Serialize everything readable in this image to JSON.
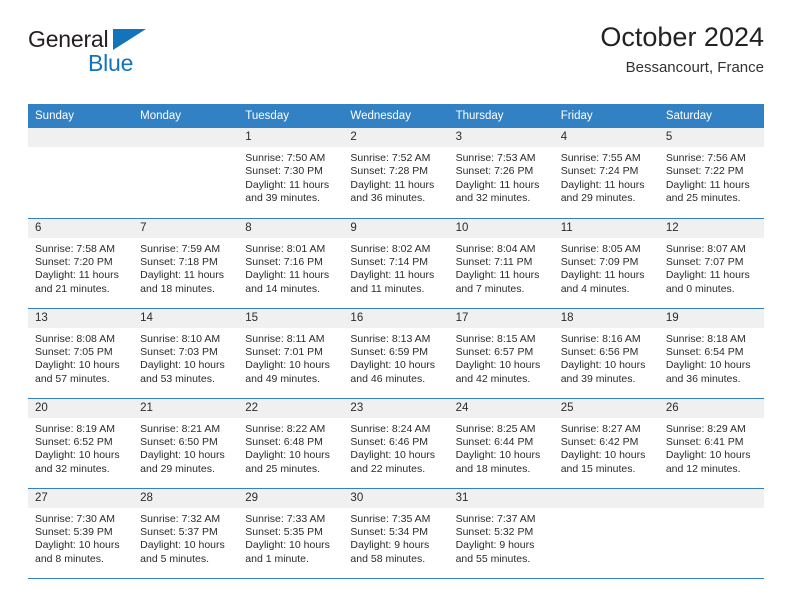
{
  "brand": {
    "name_dark": "General",
    "name_blue": "Blue",
    "triangle_icon": "blue-triangle-logo-mark"
  },
  "header": {
    "title": "October 2024",
    "location": "Bessancourt, France"
  },
  "colors": {
    "header_blue": "#3281c4",
    "brand_blue": "#1474bb",
    "daynum_band": "#f0f0f0",
    "text": "#2b2b2b"
  },
  "weekday_headers": [
    "Sunday",
    "Monday",
    "Tuesday",
    "Wednesday",
    "Thursday",
    "Friday",
    "Saturday"
  ],
  "labels": {
    "sunrise_prefix": "Sunrise:",
    "sunset_prefix": "Sunset:",
    "daylight_prefix": "Daylight:"
  },
  "weeks": [
    [
      {
        "day": "",
        "sunrise": "",
        "sunset": "",
        "daylight_line1": "",
        "daylight_line2": ""
      },
      {
        "day": "",
        "sunrise": "",
        "sunset": "",
        "daylight_line1": "",
        "daylight_line2": ""
      },
      {
        "day": "1",
        "sunrise": "Sunrise: 7:50 AM",
        "sunset": "Sunset: 7:30 PM",
        "daylight_line1": "Daylight: 11 hours",
        "daylight_line2": "and 39 minutes."
      },
      {
        "day": "2",
        "sunrise": "Sunrise: 7:52 AM",
        "sunset": "Sunset: 7:28 PM",
        "daylight_line1": "Daylight: 11 hours",
        "daylight_line2": "and 36 minutes."
      },
      {
        "day": "3",
        "sunrise": "Sunrise: 7:53 AM",
        "sunset": "Sunset: 7:26 PM",
        "daylight_line1": "Daylight: 11 hours",
        "daylight_line2": "and 32 minutes."
      },
      {
        "day": "4",
        "sunrise": "Sunrise: 7:55 AM",
        "sunset": "Sunset: 7:24 PM",
        "daylight_line1": "Daylight: 11 hours",
        "daylight_line2": "and 29 minutes."
      },
      {
        "day": "5",
        "sunrise": "Sunrise: 7:56 AM",
        "sunset": "Sunset: 7:22 PM",
        "daylight_line1": "Daylight: 11 hours",
        "daylight_line2": "and 25 minutes."
      }
    ],
    [
      {
        "day": "6",
        "sunrise": "Sunrise: 7:58 AM",
        "sunset": "Sunset: 7:20 PM",
        "daylight_line1": "Daylight: 11 hours",
        "daylight_line2": "and 21 minutes."
      },
      {
        "day": "7",
        "sunrise": "Sunrise: 7:59 AM",
        "sunset": "Sunset: 7:18 PM",
        "daylight_line1": "Daylight: 11 hours",
        "daylight_line2": "and 18 minutes."
      },
      {
        "day": "8",
        "sunrise": "Sunrise: 8:01 AM",
        "sunset": "Sunset: 7:16 PM",
        "daylight_line1": "Daylight: 11 hours",
        "daylight_line2": "and 14 minutes."
      },
      {
        "day": "9",
        "sunrise": "Sunrise: 8:02 AM",
        "sunset": "Sunset: 7:14 PM",
        "daylight_line1": "Daylight: 11 hours",
        "daylight_line2": "and 11 minutes."
      },
      {
        "day": "10",
        "sunrise": "Sunrise: 8:04 AM",
        "sunset": "Sunset: 7:11 PM",
        "daylight_line1": "Daylight: 11 hours",
        "daylight_line2": "and 7 minutes."
      },
      {
        "day": "11",
        "sunrise": "Sunrise: 8:05 AM",
        "sunset": "Sunset: 7:09 PM",
        "daylight_line1": "Daylight: 11 hours",
        "daylight_line2": "and 4 minutes."
      },
      {
        "day": "12",
        "sunrise": "Sunrise: 8:07 AM",
        "sunset": "Sunset: 7:07 PM",
        "daylight_line1": "Daylight: 11 hours",
        "daylight_line2": "and 0 minutes."
      }
    ],
    [
      {
        "day": "13",
        "sunrise": "Sunrise: 8:08 AM",
        "sunset": "Sunset: 7:05 PM",
        "daylight_line1": "Daylight: 10 hours",
        "daylight_line2": "and 57 minutes."
      },
      {
        "day": "14",
        "sunrise": "Sunrise: 8:10 AM",
        "sunset": "Sunset: 7:03 PM",
        "daylight_line1": "Daylight: 10 hours",
        "daylight_line2": "and 53 minutes."
      },
      {
        "day": "15",
        "sunrise": "Sunrise: 8:11 AM",
        "sunset": "Sunset: 7:01 PM",
        "daylight_line1": "Daylight: 10 hours",
        "daylight_line2": "and 49 minutes."
      },
      {
        "day": "16",
        "sunrise": "Sunrise: 8:13 AM",
        "sunset": "Sunset: 6:59 PM",
        "daylight_line1": "Daylight: 10 hours",
        "daylight_line2": "and 46 minutes."
      },
      {
        "day": "17",
        "sunrise": "Sunrise: 8:15 AM",
        "sunset": "Sunset: 6:57 PM",
        "daylight_line1": "Daylight: 10 hours",
        "daylight_line2": "and 42 minutes."
      },
      {
        "day": "18",
        "sunrise": "Sunrise: 8:16 AM",
        "sunset": "Sunset: 6:56 PM",
        "daylight_line1": "Daylight: 10 hours",
        "daylight_line2": "and 39 minutes."
      },
      {
        "day": "19",
        "sunrise": "Sunrise: 8:18 AM",
        "sunset": "Sunset: 6:54 PM",
        "daylight_line1": "Daylight: 10 hours",
        "daylight_line2": "and 36 minutes."
      }
    ],
    [
      {
        "day": "20",
        "sunrise": "Sunrise: 8:19 AM",
        "sunset": "Sunset: 6:52 PM",
        "daylight_line1": "Daylight: 10 hours",
        "daylight_line2": "and 32 minutes."
      },
      {
        "day": "21",
        "sunrise": "Sunrise: 8:21 AM",
        "sunset": "Sunset: 6:50 PM",
        "daylight_line1": "Daylight: 10 hours",
        "daylight_line2": "and 29 minutes."
      },
      {
        "day": "22",
        "sunrise": "Sunrise: 8:22 AM",
        "sunset": "Sunset: 6:48 PM",
        "daylight_line1": "Daylight: 10 hours",
        "daylight_line2": "and 25 minutes."
      },
      {
        "day": "23",
        "sunrise": "Sunrise: 8:24 AM",
        "sunset": "Sunset: 6:46 PM",
        "daylight_line1": "Daylight: 10 hours",
        "daylight_line2": "and 22 minutes."
      },
      {
        "day": "24",
        "sunrise": "Sunrise: 8:25 AM",
        "sunset": "Sunset: 6:44 PM",
        "daylight_line1": "Daylight: 10 hours",
        "daylight_line2": "and 18 minutes."
      },
      {
        "day": "25",
        "sunrise": "Sunrise: 8:27 AM",
        "sunset": "Sunset: 6:42 PM",
        "daylight_line1": "Daylight: 10 hours",
        "daylight_line2": "and 15 minutes."
      },
      {
        "day": "26",
        "sunrise": "Sunrise: 8:29 AM",
        "sunset": "Sunset: 6:41 PM",
        "daylight_line1": "Daylight: 10 hours",
        "daylight_line2": "and 12 minutes."
      }
    ],
    [
      {
        "day": "27",
        "sunrise": "Sunrise: 7:30 AM",
        "sunset": "Sunset: 5:39 PM",
        "daylight_line1": "Daylight: 10 hours",
        "daylight_line2": "and 8 minutes."
      },
      {
        "day": "28",
        "sunrise": "Sunrise: 7:32 AM",
        "sunset": "Sunset: 5:37 PM",
        "daylight_line1": "Daylight: 10 hours",
        "daylight_line2": "and 5 minutes."
      },
      {
        "day": "29",
        "sunrise": "Sunrise: 7:33 AM",
        "sunset": "Sunset: 5:35 PM",
        "daylight_line1": "Daylight: 10 hours",
        "daylight_line2": "and 1 minute."
      },
      {
        "day": "30",
        "sunrise": "Sunrise: 7:35 AM",
        "sunset": "Sunset: 5:34 PM",
        "daylight_line1": "Daylight: 9 hours",
        "daylight_line2": "and 58 minutes."
      },
      {
        "day": "31",
        "sunrise": "Sunrise: 7:37 AM",
        "sunset": "Sunset: 5:32 PM",
        "daylight_line1": "Daylight: 9 hours",
        "daylight_line2": "and 55 minutes."
      },
      {
        "day": "",
        "sunrise": "",
        "sunset": "",
        "daylight_line1": "",
        "daylight_line2": ""
      },
      {
        "day": "",
        "sunrise": "",
        "sunset": "",
        "daylight_line1": "",
        "daylight_line2": ""
      }
    ]
  ]
}
